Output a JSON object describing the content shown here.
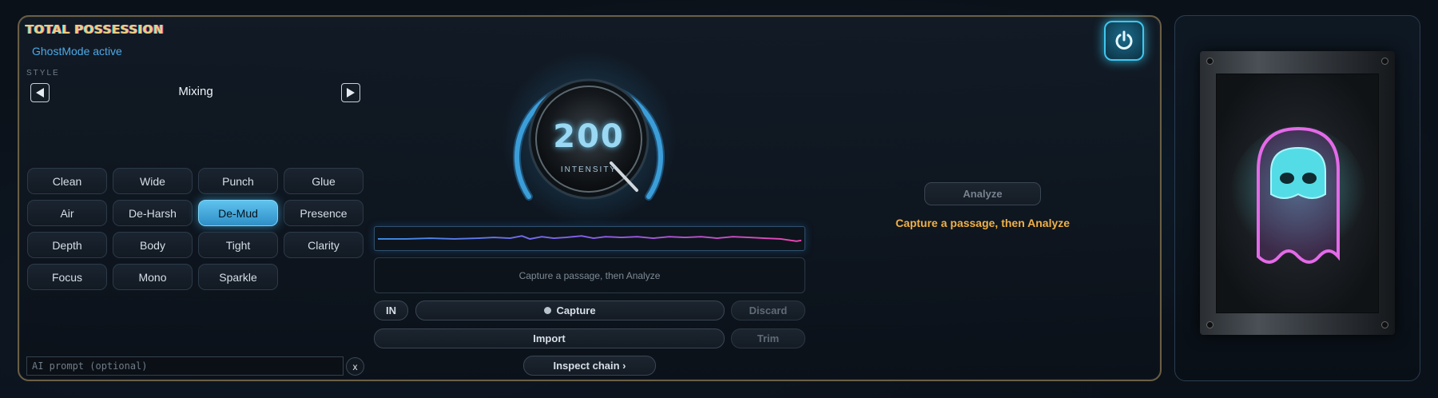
{
  "app": {
    "title": "TOTAL POSSESSION",
    "status": "GhostMode active"
  },
  "style": {
    "label": "STYLE",
    "value": "Mixing",
    "prev_icon": "left-triangle-icon",
    "next_icon": "right-triangle-icon"
  },
  "presets": [
    {
      "label": "Clean",
      "active": false
    },
    {
      "label": "Wide",
      "active": false
    },
    {
      "label": "Punch",
      "active": false
    },
    {
      "label": "Glue",
      "active": false
    },
    {
      "label": "Air",
      "active": false
    },
    {
      "label": "De-Harsh",
      "active": false
    },
    {
      "label": "De-Mud",
      "active": true
    },
    {
      "label": "Presence",
      "active": false
    },
    {
      "label": "Depth",
      "active": false
    },
    {
      "label": "Body",
      "active": false
    },
    {
      "label": "Tight",
      "active": false
    },
    {
      "label": "Clarity",
      "active": false
    },
    {
      "label": "Focus",
      "active": false
    },
    {
      "label": "Mono",
      "active": false
    },
    {
      "label": "Sparkle",
      "active": false
    }
  ],
  "ai": {
    "placeholder": "AI prompt (optional)",
    "value": "",
    "clear_label": "x"
  },
  "knob": {
    "value": "200",
    "label": "INTENSITY"
  },
  "capture": {
    "message": "Capture a passage, then Analyze",
    "in_label": "IN",
    "capture_label": "Capture",
    "discard_label": "Discard",
    "import_label": "Import",
    "trim_label": "Trim",
    "inspect_label": "Inspect chain ›"
  },
  "analyze": {
    "button_label": "Analyze",
    "hint": "Capture a passage, then Analyze"
  },
  "colors": {
    "accent": "#4ea9e6",
    "active_preset": "#4fb6e8",
    "hint": "#f0b046",
    "brand": "#f0cd7a"
  },
  "icons": {
    "power": "power-icon",
    "ghost": "ghost-icon"
  }
}
